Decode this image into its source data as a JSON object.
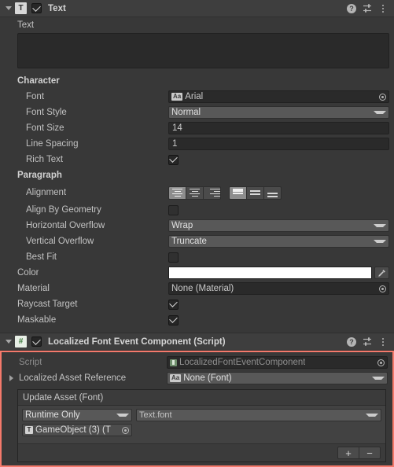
{
  "components": [
    {
      "id": "text-component",
      "title": "Text",
      "icon": "T",
      "enabled": true,
      "header_icons": {
        "help": "?",
        "preset": "preset-icon",
        "menu": "kebab-menu-icon"
      },
      "text_field": {
        "label": "Text",
        "value": "",
        "placeholder": ""
      },
      "sections": [
        {
          "title": "Character",
          "rows": [
            {
              "label": "Font",
              "type": "object",
              "value": "Arial",
              "badge": "Aa"
            },
            {
              "label": "Font Style",
              "type": "dropdown",
              "value": "Normal"
            },
            {
              "label": "Font Size",
              "type": "input",
              "value": "14"
            },
            {
              "label": "Line Spacing",
              "type": "input",
              "value": "1"
            },
            {
              "label": "Rich Text",
              "type": "checkbox",
              "value": true
            }
          ]
        },
        {
          "title": "Paragraph",
          "rows": [
            {
              "label": "Alignment",
              "type": "alignment"
            },
            {
              "label": "Align By Geometry",
              "type": "checkbox",
              "value": false
            },
            {
              "label": "Horizontal Overflow",
              "type": "dropdown",
              "value": "Wrap"
            },
            {
              "label": "Vertical Overflow",
              "type": "dropdown",
              "value": "Truncate"
            },
            {
              "label": "Best Fit",
              "type": "checkbox",
              "value": false
            }
          ]
        }
      ],
      "tail_rows": [
        {
          "label": "Color",
          "type": "color",
          "value": "#FFFFFF"
        },
        {
          "label": "Material",
          "type": "object",
          "value": "None (Material)"
        },
        {
          "label": "Raycast Target",
          "type": "checkbox",
          "value": true
        },
        {
          "label": "Maskable",
          "type": "checkbox",
          "value": true
        }
      ],
      "alignment": {
        "horizontal_options": [
          "align-left",
          "align-center",
          "align-right"
        ],
        "horizontal_selected": 0,
        "vertical_options": [
          "align-top",
          "align-middle",
          "align-bottom"
        ],
        "vertical_selected": 0
      }
    },
    {
      "id": "localized-font-event-component",
      "title": "Localized Font Event Component (Script)",
      "icon": "#",
      "enabled": true,
      "highlighted": true,
      "highlight_color": "#F4796B",
      "rows": [
        {
          "label": "Script",
          "type": "object",
          "value": "LocalizedFontEventComponent",
          "readonly": true
        },
        {
          "label": "Localized Asset Reference",
          "type": "dropdown",
          "value": "None (Font)",
          "badge": "Aa",
          "foldout": true
        }
      ],
      "event": {
        "title": "Update Asset (Font)",
        "entries": [
          {
            "mode": "Runtime Only",
            "target_function": "Text.font",
            "object": "GameObject (3) (T"
          }
        ],
        "add_label": "+",
        "remove_label": "−"
      }
    }
  ]
}
